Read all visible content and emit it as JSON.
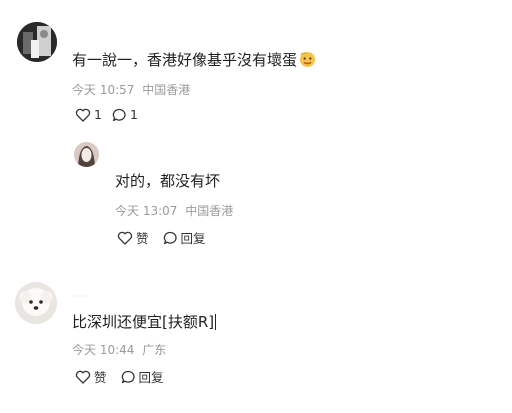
{
  "comments": [
    {
      "text": "有一說一，香港好像基乎沒有壞蛋",
      "emoji": "face-emoji",
      "time": "今天 10:57",
      "location": "中国香港",
      "likes": "1",
      "replies": "1",
      "reply": {
        "text": "对的，都没有坏",
        "time": "今天 13:07",
        "location": "中国香港",
        "like_label": "赞",
        "reply_label": "回复"
      }
    },
    {
      "username": "····",
      "text": "比深圳还便宜[扶额R]",
      "time": "今天 10:44",
      "location": "广东",
      "like_label": "赞",
      "reply_label": "回复"
    }
  ],
  "colors": {
    "text": "#222222",
    "meta": "#9a9a9a",
    "icon": "#333333"
  }
}
